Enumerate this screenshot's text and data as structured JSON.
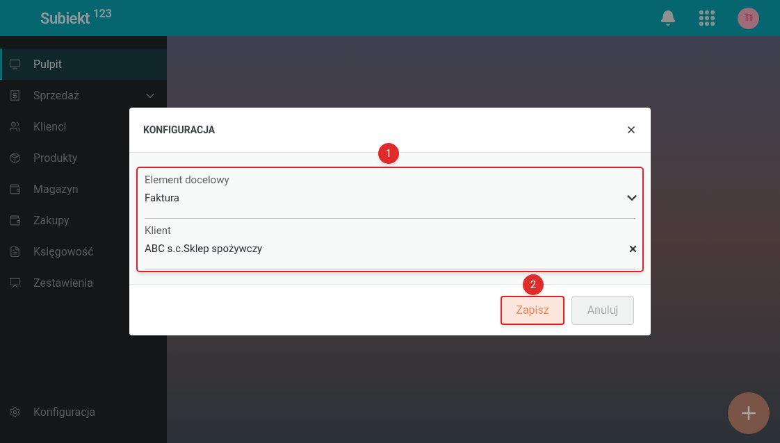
{
  "header": {
    "logo": "Subiekt $^{123}$",
    "avatar": "TI"
  },
  "sidebar": {
    "items": [
      {
        "label": "Pulpit",
        "kind": "link",
        "selected": true
      },
      {
        "label": "Sprzedaż",
        "kind": "group",
        "selected": false
      },
      {
        "label": "Klienci",
        "kind": "link",
        "selected": false
      },
      {
        "label": "Produkty",
        "kind": "link",
        "selected": false
      },
      {
        "label": "Magazyn",
        "kind": "link",
        "selected": false
      },
      {
        "label": "Zakupy",
        "kind": "link",
        "selected": false
      },
      {
        "label": "Księgowość",
        "kind": "link",
        "selected": false
      },
      {
        "label": "Zestawienia",
        "kind": "link",
        "selected": false
      }
    ],
    "footer_item": {
      "label": "Konfiguracja"
    }
  },
  "dialog": {
    "title": "KONFIGURACJA",
    "fields": [
      {
        "label": "Element docelowy",
        "value": "Faktura",
        "kind": "select"
      },
      {
        "label": "Klient",
        "value": "ABC s.c.Sklep spożywczy",
        "kind": "clearable"
      }
    ],
    "buttons": [
      {
        "label": "Zapisz",
        "kind": "primary"
      },
      {
        "label": "Anuluj",
        "kind": "secondary"
      }
    ],
    "markers": [
      {
        "label": "1"
      },
      {
        "label": "2"
      }
    ]
  }
}
